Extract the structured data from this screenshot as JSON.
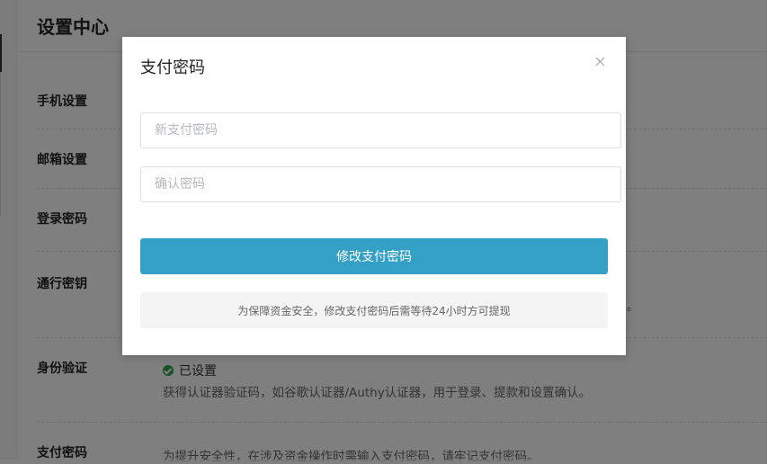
{
  "page": {
    "title": "设置中心",
    "rows": [
      {
        "label": "手机设置"
      },
      {
        "label": "邮箱设置"
      },
      {
        "label": "登录密码"
      },
      {
        "label": "通行密钥"
      },
      {
        "label": "身份验证"
      },
      {
        "label": "支付密码"
      }
    ],
    "auth_status": "已设置",
    "auth_desc": "获得认证器验证码，如谷歌认证器/Authy认证器，用于登录、提款和设置确认。",
    "pay_desc": "为提升安全性，在涉及资金操作时需输入支付密码，请牢记支付密码。",
    "passkey_trailing": "。"
  },
  "modal": {
    "title": "支付密码",
    "new_password_placeholder": "新支付密码",
    "confirm_password_placeholder": "确认密码",
    "submit_label": "修改支付密码",
    "notice": "为保障资金安全，修改支付密码后需等待24小时方可提现"
  },
  "colors": {
    "primary": "#35a0c6",
    "success": "#2ea44f"
  },
  "icons": {
    "close": "close-icon",
    "check": "check-circle-icon"
  }
}
